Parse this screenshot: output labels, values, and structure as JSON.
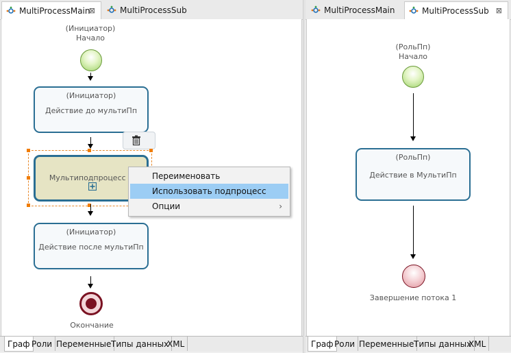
{
  "left_pane": {
    "tabs": [
      {
        "label": "MultiProcessMain",
        "active": true,
        "close": "⊠"
      },
      {
        "label": "MultiProcessSub",
        "active": false
      }
    ],
    "start": {
      "role": "(Инициатор)",
      "name": "Начало"
    },
    "action_before": {
      "role": "(Инициатор)",
      "name": "Действие до мультиПп"
    },
    "multiprocess": {
      "name": "Мультиподпроцесс 1"
    },
    "action_after": {
      "role": "(Инициатор)",
      "name": "Действие после мультиПп"
    },
    "end": {
      "name": "Окончание"
    },
    "context_menu": {
      "items": [
        {
          "label": "Переименовать"
        },
        {
          "label": "Использовать подпроцесс",
          "highlighted": true
        },
        {
          "label": "Опции",
          "submenu": "›"
        }
      ]
    },
    "bottom_tabs": [
      "Граф",
      "Роли",
      "Переменные",
      "Типы данных",
      "XML"
    ]
  },
  "right_pane": {
    "tabs": [
      {
        "label": "MultiProcessMain",
        "active": false
      },
      {
        "label": "MultiProcessSub",
        "active": true,
        "close": "⊠"
      }
    ],
    "start": {
      "role": "(РольПп)",
      "name": "Начало"
    },
    "action": {
      "role": "(РольПп)",
      "name": "Действие в МультиПп"
    },
    "end": {
      "name": "Завершение потока 1"
    },
    "bottom_tabs": [
      "Граф",
      "Роли",
      "Переменные",
      "Типы данных",
      "XML"
    ]
  },
  "colors": {
    "node_border": "#2a6e93",
    "multiprocess_fill": "#e6e4c4",
    "selection": "#e8892a",
    "menu_highlight": "#9ccdf4",
    "end_fill": "#7a1222"
  }
}
